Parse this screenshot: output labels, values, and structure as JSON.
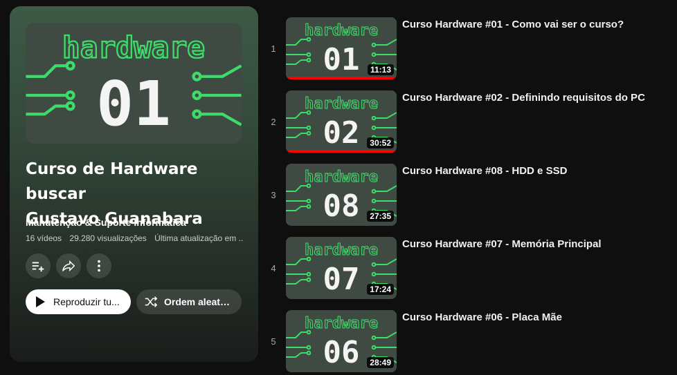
{
  "playlist": {
    "thumb_number": "01",
    "thumb_word": "hardware",
    "title_line1": "Curso de Hardware buscar",
    "title_line2": "Gustavo Guanabara",
    "owner": "Manutenção & Suporte Informática",
    "video_count": "16 vídeos",
    "views": "29.280 visualizações",
    "last_updated": "Última atualização em ...",
    "play_all_label": "Reproduzir tu...",
    "shuffle_label": "Ordem aleató...",
    "icons": [
      "add-to-queue-icon",
      "share-icon",
      "more-vertical-icon",
      "play-icon",
      "shuffle-icon"
    ]
  },
  "colors": {
    "accent_green": "#3ddc6a",
    "progress_red": "#ff0000",
    "thumb_bg": "#3f4a42"
  },
  "videos": [
    {
      "index": "1",
      "number": "01",
      "word": "hardware",
      "duration": "11:13",
      "watched_fraction": 1.0,
      "title": "Curso Hardware #01 - Como vai ser o curso?"
    },
    {
      "index": "2",
      "number": "02",
      "word": "hardware",
      "duration": "30:52",
      "watched_fraction": 1.0,
      "title": "Curso Hardware #02 - Definindo requisitos do PC"
    },
    {
      "index": "3",
      "number": "08",
      "word": "hardware",
      "duration": "27:35",
      "watched_fraction": 0,
      "title": "Curso Hardware #08 - HDD e SSD"
    },
    {
      "index": "4",
      "number": "07",
      "word": "hardware",
      "duration": "17:24",
      "watched_fraction": 0,
      "title": "Curso Hardware #07 - Memória Principal"
    },
    {
      "index": "5",
      "number": "06",
      "word": "hardware",
      "duration": "28:49",
      "watched_fraction": 0,
      "title": "Curso Hardware #06 - Placa Mãe"
    }
  ]
}
